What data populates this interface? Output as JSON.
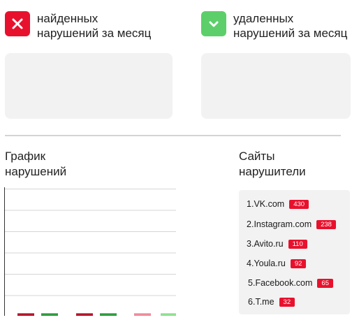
{
  "stats": {
    "found": {
      "icon": "close-icon",
      "color": "#e8112d",
      "label_line1": "найденных",
      "label_line2": "нарушений за месяц"
    },
    "removed": {
      "icon": "chevron-down-icon",
      "color": "#5ccf6a",
      "label_line1": "удаленных",
      "label_line2": "нарушений за месяц"
    }
  },
  "chart_section": {
    "title_line1": "График",
    "title_line2": "нарушений"
  },
  "sites_section": {
    "title_line1": "Сайты",
    "title_line2": "нарушители",
    "badge_color": "#e8112d",
    "items": [
      {
        "rank": "1.",
        "name": "VK.com",
        "count": "430"
      },
      {
        "rank": "2.",
        "name": "Instagram.com",
        "count": "238"
      },
      {
        "rank": "3.",
        "name": "Avito.ru",
        "count": "110"
      },
      {
        "rank": "4.",
        "name": "Youla.ru",
        "count": "92"
      },
      {
        "rank": "5.",
        "name": "Facebook.com",
        "count": "65"
      },
      {
        "rank": "6.",
        "name": "T.me",
        "count": "32"
      }
    ]
  },
  "chart_data": {
    "type": "bar",
    "title": "",
    "grid": true,
    "series_colors": [
      "#b5162c",
      "#2e9e3e",
      "#f08a9a",
      "#8fe08f"
    ],
    "bars": [
      {
        "color": "#b5162c",
        "value": 0.02
      },
      {
        "color": "#2e9e3e",
        "value": 0.02
      },
      {
        "color": "#b5162c",
        "value": 0.02
      },
      {
        "color": "#2e9e3e",
        "value": 0.02
      },
      {
        "color": "#f08a9a",
        "value": 0.02
      },
      {
        "color": "#8fe08f",
        "value": 0.02
      }
    ]
  }
}
